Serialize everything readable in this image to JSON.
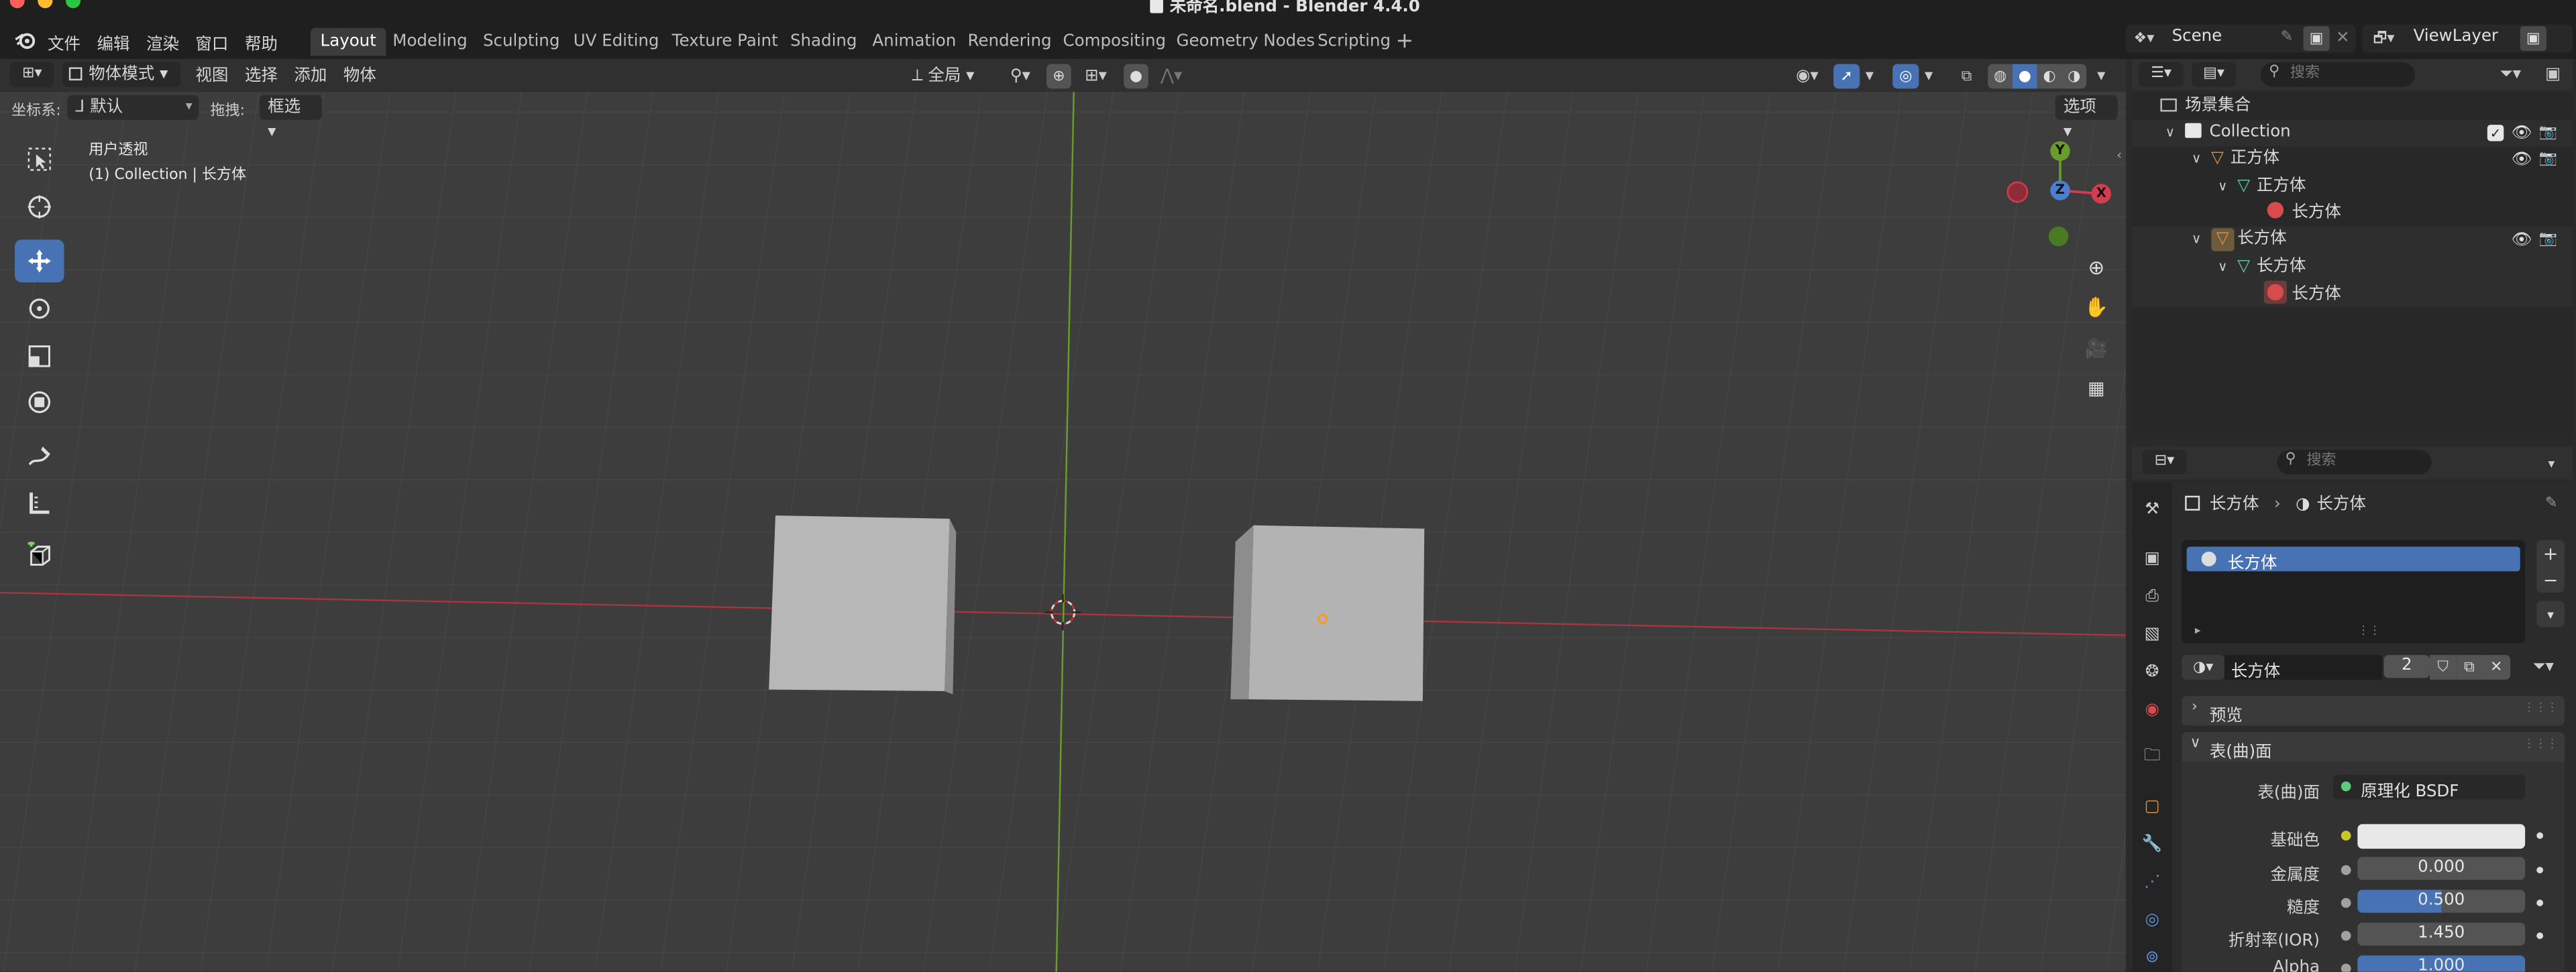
{
  "titlebar": {
    "title": "未命名.blend - Blender 4.4.0"
  },
  "menu": [
    "文件",
    "编辑",
    "渲染",
    "窗口",
    "帮助"
  ],
  "workspaces": [
    "Layout",
    "Modeling",
    "Sculpting",
    "UV Editing",
    "Texture Paint",
    "Shading",
    "Animation",
    "Rendering",
    "Compositing",
    "Geometry Nodes",
    "Scripting"
  ],
  "active_workspace": "Layout",
  "scene": {
    "name": "Scene",
    "view_layer": "ViewLayer"
  },
  "viewport_header": {
    "mode": "物体模式",
    "menus": [
      "视图",
      "选择",
      "添加",
      "物体"
    ],
    "pivot": "全局",
    "coord_label": "坐标系:",
    "coord_value": "默认",
    "drag_label": "拖拽:",
    "drag_value": "框选",
    "options": "选项"
  },
  "viewport_info": {
    "line1": "用户透视",
    "line2": "(1) Collection | 长方体"
  },
  "gizmo": {
    "x": "X",
    "y": "Y",
    "z": "Z"
  },
  "outliner": {
    "search_placeholder": "搜索",
    "root": "场景集合",
    "collection": "Collection",
    "items": [
      {
        "label": "正方体",
        "kind": "object"
      },
      {
        "label": "正方体",
        "kind": "mesh"
      },
      {
        "label": "长方体",
        "kind": "material"
      },
      {
        "label": "长方体",
        "kind": "object"
      },
      {
        "label": "长方体",
        "kind": "mesh"
      },
      {
        "label": "长方体",
        "kind": "material"
      }
    ]
  },
  "properties": {
    "search_placeholder": "搜索",
    "breadcrumb_object": "长方体",
    "breadcrumb_material": "长方体",
    "slot_name": "长方体",
    "material_name": "长方体",
    "user_count": "2",
    "panel_preview": "预览",
    "panel_surface": "表(曲)面",
    "surface_label": "表(曲)面",
    "surface_value": "原理化 BSDF",
    "fields": [
      {
        "label": "基础色",
        "value": ""
      },
      {
        "label": "金属度",
        "value": "0.000"
      },
      {
        "label": "糙度",
        "value": "0.500"
      },
      {
        "label": "折射率(IOR)",
        "value": "1.450"
      },
      {
        "label": "Alpha",
        "value": "1.000"
      }
    ]
  },
  "colors": {
    "accent": "#4772b3",
    "x_axis": "#d33d4d",
    "y_axis": "#6a9c2c",
    "z_axis": "#4a7fd4",
    "outliner_active_row": "#334d80"
  }
}
